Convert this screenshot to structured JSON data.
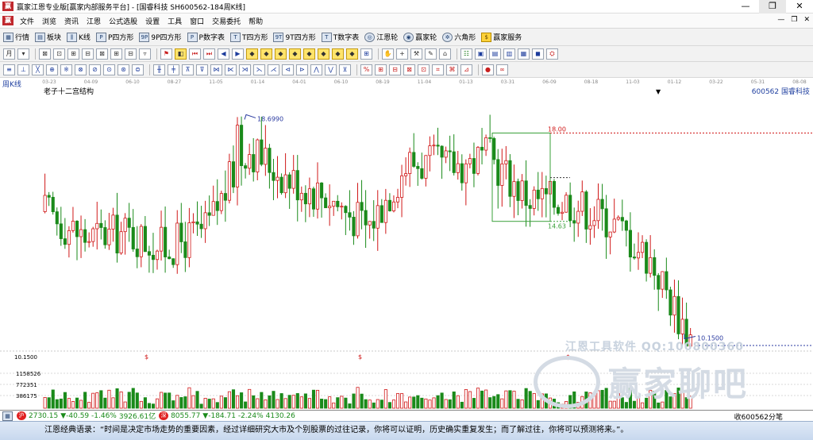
{
  "window": {
    "title": "赢家江恩专业版[赢家内部服务平台] - [国睿科技  SH600562-184周K线]",
    "logo_text": "赢",
    "controls": [
      "—",
      "❐",
      "✕"
    ]
  },
  "menu": {
    "items": [
      "文件",
      "浏览",
      "资讯",
      "江恩",
      "公式选股",
      "设置",
      "工具",
      "窗口",
      "交易委托",
      "帮助"
    ],
    "mdi_controls": [
      "—",
      "❐",
      "✕"
    ]
  },
  "toolbar": {
    "buttons": [
      {
        "icon": "grid-icon",
        "glyph": "▦",
        "label": "行情"
      },
      {
        "icon": "blocks-icon",
        "glyph": "▤",
        "label": "板块"
      },
      {
        "icon": "kline-icon",
        "glyph": "⫼",
        "label": "K线"
      },
      {
        "icon": "p-square-icon",
        "glyph": "P",
        "label": "P四方形"
      },
      {
        "icon": "9p-square-icon",
        "glyph": "9P",
        "label": "9P四方形"
      },
      {
        "icon": "p-number-icon",
        "glyph": "P",
        "label": "P数字表"
      },
      {
        "icon": "t-square-icon",
        "glyph": "T",
        "label": "T四方形"
      },
      {
        "icon": "9t-square-icon",
        "glyph": "9T",
        "label": "9T四方形"
      },
      {
        "icon": "t-number-icon",
        "glyph": "T",
        "label": "T数字表"
      },
      {
        "icon": "gann-wheel-icon",
        "glyph": "◎",
        "label": "江恩轮"
      },
      {
        "icon": "winner-wheel-icon",
        "glyph": "◉",
        "label": "赢家轮"
      },
      {
        "icon": "hexagon-icon",
        "glyph": "✲",
        "label": "六角形"
      },
      {
        "icon": "dollar-icon",
        "glyph": "$",
        "label": "赢家服务"
      }
    ]
  },
  "tools_row2": [
    "月",
    "▾",
    "⊠",
    "⊡",
    "⊞",
    "⊟",
    "⊠",
    "⊞",
    "⊟",
    "▿",
    "⚑",
    "◧",
    "⏮",
    "⏭",
    "◀",
    "▶",
    "◆",
    "◆",
    "◆",
    "◆",
    "◆",
    "◆",
    "◆",
    "◆",
    "⊞",
    "✋",
    "+",
    "⚒",
    "✎",
    "⌂",
    "☷",
    "▣",
    "▤",
    "▥",
    "▦",
    "◼",
    "⛭"
  ],
  "tools_row3": [
    "≡",
    "⊥",
    "╳",
    "⊕",
    "※",
    "⊗",
    "⊘",
    "⊙",
    "⊛",
    "⊜",
    "╫",
    "╪",
    "⊼",
    "⊽",
    "⋈",
    "⋉",
    "⋊",
    "⋋",
    "⋌",
    "⊲",
    "⊳",
    "⋀",
    "⋁",
    "⊻",
    "%",
    "⊞",
    "⊟",
    "⊠",
    "⊡",
    "⌗",
    "⌘",
    "⊿",
    "●",
    "∞"
  ],
  "chart": {
    "period": "周K线",
    "structure": "老子十二宫结构",
    "stock": "600562 国睿科技",
    "dropdown_glyph": "▼",
    "date_ticks": [
      "03-23",
      "04-09",
      "06-10",
      "08-27",
      "11-05",
      "01-14",
      "04-01",
      "06-10",
      "08-19",
      "11-04",
      "01-13",
      "03-31",
      "06-09",
      "08-18",
      "11-03",
      "01-12",
      "03-22",
      "05-31",
      "08-08"
    ],
    "labels": {
      "high": "18.6990",
      "level_top": "18.00",
      "level_bottom": "14.63",
      "low": "10.1500",
      "price_axis_low": "10.1500",
      "volume_ticks": [
        "1158526",
        "772351",
        "386175"
      ],
      "dollar_marks": [
        "$",
        "$",
        "$"
      ]
    },
    "colors": {
      "up": "#d01818",
      "down": "#1a8a1a",
      "box": "#3aa03a",
      "level": "#d01818",
      "annot": "#2a3aa0"
    },
    "watermark": {
      "line1": "江恩工具软件  QQ:100800360",
      "line2": "赢家聊吧",
      "line3": "jiaoba.yc558.com"
    }
  },
  "chart_data": {
    "type": "candlestick",
    "title": "老子十二宫结构",
    "ylim": [
      9.5,
      19.5
    ],
    "annotations": [
      {
        "label": "18.6990",
        "value": 18.699
      },
      {
        "label": "18.00",
        "value": 18.0
      },
      {
        "label": "14.63",
        "value": 14.63
      },
      {
        "label": "10.1500",
        "value": 10.15
      }
    ],
    "x": [
      "03-23",
      "04-09",
      "06-10",
      "08-27",
      "11-05",
      "01-14",
      "04-01",
      "06-10",
      "08-19",
      "11-04",
      "01-13",
      "03-31",
      "06-09",
      "08-18",
      "11-03",
      "01-12",
      "03-22",
      "05-31",
      "08-08"
    ],
    "close_trend": [
      15.0,
      14.0,
      14.2,
      13.6,
      14.3,
      17.5,
      16.3,
      15.6,
      14.4,
      16.9,
      16.7,
      17.1,
      15.5,
      15.4,
      14.7,
      13.2,
      10.15
    ]
  },
  "status": {
    "sh_badge": "沪",
    "sh_text": "2730.15",
    "sh_change": "▼-40.59 -1.46%",
    "sh_amount": "3926.61亿",
    "sz_badge": "深",
    "sz_text": "8055.77",
    "sz_change": "▼-184.71 -2.24%",
    "sz_amount": "4130.26",
    "right_text": "收600562分笔"
  },
  "quote": "江恩经典语录：“时间是决定市场走势的重要因素，经过详细研究大市及个别股票的过往记录，你将可以证明，历史确实重复发生；而了解过往，你将可以预测将来。”。"
}
